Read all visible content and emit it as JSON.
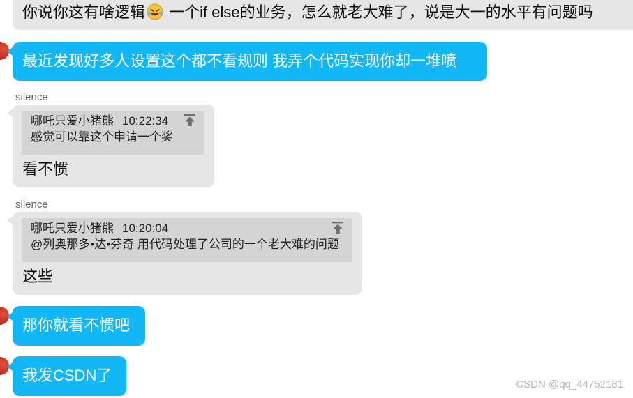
{
  "messages": [
    {
      "type": "incoming",
      "text_before_emoji": "你说你这有啥逻辑",
      "emoji": "laughing-crying-emoji",
      "text_after_emoji": " 一个if else的业务，怎么就老大难了，说是大一的水平有问题吗"
    },
    {
      "type": "outgoing",
      "text": "最近发现好多人设置这个都不看规则 我弄个代码实现你却一堆喷"
    },
    {
      "type": "incoming-reply",
      "sender": "silence",
      "quote": {
        "author": "哪吒只爱小猪熊",
        "time": "10:22:34",
        "text": "感觉可以靠这个申请一个奖"
      },
      "text": "看不惯"
    },
    {
      "type": "incoming-reply",
      "sender": "silence",
      "quote": {
        "author": "哪吒只爱小猪熊",
        "time": "10:20:04",
        "text": "@列奥那多•达•芬奇 用代码处理了公司的一个老大难的问题"
      },
      "text": "这些"
    },
    {
      "type": "outgoing",
      "text": "那你就看不惯吧"
    },
    {
      "type": "outgoing",
      "text": "我发CSDN了"
    }
  ],
  "watermark": "CSDN @qq_44752181",
  "colors": {
    "incoming_bubble": "#e6e6e6",
    "outgoing_bubble": "#12b7f5",
    "quote_box": "#d4d4d4"
  },
  "icons": {
    "quote_jump": "pin-to-top-icon",
    "avatar": "avatar"
  }
}
